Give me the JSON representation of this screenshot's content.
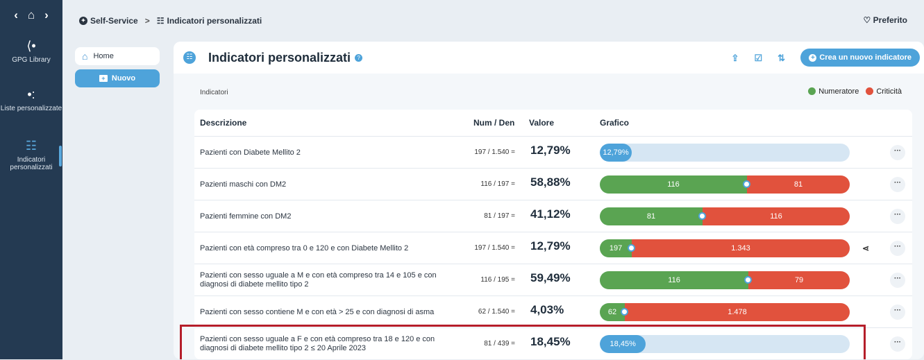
{
  "rail": {
    "nav": [
      "‹",
      "⌂",
      "›"
    ],
    "items": [
      {
        "label": "GPG Library",
        "icon": "share-icon"
      },
      {
        "label": "Liste personalizzate",
        "icon": "list-share-icon"
      },
      {
        "label": "Indicatori personalizzati",
        "icon": "list-icon"
      }
    ]
  },
  "breadcrumb": {
    "root": "Self-Service",
    "sep": ">",
    "current": "Indicatori personalizzati"
  },
  "favorite": "♡ Preferito",
  "side": {
    "home": "Home",
    "new": "Nuovo"
  },
  "header": {
    "title": "Indicatori personalizzati",
    "create": "Crea un nuovo indicatore"
  },
  "section": {
    "label": "Indicatori",
    "legend": [
      {
        "label": "Numeratore",
        "color": "#5aa452"
      },
      {
        "label": "Criticità",
        "color": "#e1523d"
      }
    ]
  },
  "columns": {
    "desc": "Descrizione",
    "numden": "Num / Den",
    "valore": "Valore",
    "grafico": "Grafico"
  },
  "rows": [
    {
      "desc": "Pazienti con Diabete Mellito 2",
      "numden": "197 / 1.540 =",
      "value": "12,79%",
      "type": "pct",
      "pct": 12.79,
      "bar_label": "12,79%"
    },
    {
      "desc": "Pazienti maschi con DM2",
      "numden": "116 / 197 =",
      "value": "58,88%",
      "type": "split",
      "num": 116,
      "crit": 81,
      "num_label": "116",
      "crit_label": "81"
    },
    {
      "desc": "Pazienti femmine con DM2",
      "numden": "81 / 197 =",
      "value": "41,12%",
      "type": "split",
      "num": 81,
      "crit": 116,
      "num_label": "81",
      "crit_label": "116"
    },
    {
      "desc": "Pazienti con età compreso tra 0 e 120 e con Diabete Mellito 2",
      "numden": "197 / 1.540 =",
      "value": "12,79%",
      "type": "split",
      "num": 197,
      "crit": 1343,
      "num_label": "197",
      "crit_label": "1.343",
      "share": true
    },
    {
      "desc": "Pazienti con sesso uguale a M e con età compreso tra 14 e 105 e con diagnosi di diabete mellito tipo 2",
      "numden": "116 / 195 =",
      "value": "59,49%",
      "type": "split",
      "num": 116,
      "crit": 79,
      "num_label": "116",
      "crit_label": "79"
    },
    {
      "desc": "Pazienti con sesso contiene M e con età > 25 e con diagnosi di asma",
      "numden": "62 / 1.540 =",
      "value": "4,03%",
      "type": "split",
      "num": 62,
      "crit": 1478,
      "num_label": "62",
      "crit_label": "1.478"
    },
    {
      "desc": "Pazienti con sesso uguale a F e con età compreso tra 18 e 120 e con diagnosi di diabete mellito tipo 2 ≤ 20 Aprile 2023",
      "numden": "81 / 439 =",
      "value": "18,45%",
      "type": "pct",
      "pct": 18.45,
      "bar_label": "18,45%"
    }
  ]
}
